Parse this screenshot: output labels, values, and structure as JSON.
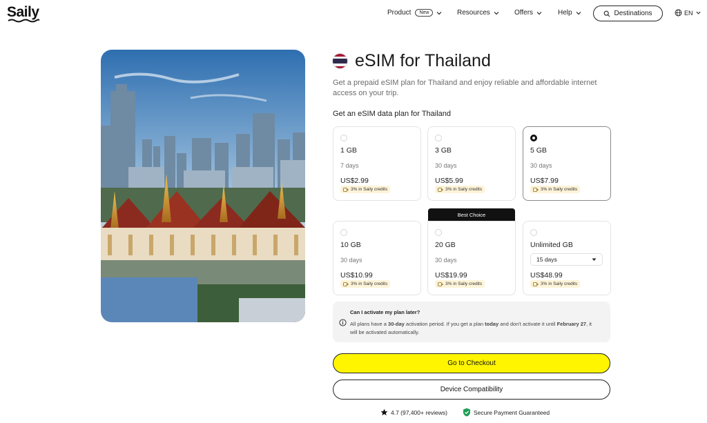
{
  "nav": {
    "logo": "Saily",
    "items": [
      {
        "label": "Product",
        "badge": "New"
      },
      {
        "label": "Resources"
      },
      {
        "label": "Offers"
      },
      {
        "label": "Help"
      }
    ],
    "destinations_label": "Destinations",
    "language": "EN"
  },
  "page": {
    "title": "eSIM for Thailand",
    "subtitle": "Get a prepaid eSIM plan for Thailand and enjoy reliable and affordable internet access on your trip.",
    "section_label": "Get an eSIM data plan for Thailand"
  },
  "flag_colors": [
    "#a51931",
    "#f4f5f8",
    "#2d2a4a",
    "#f4f5f8",
    "#a51931"
  ],
  "plans": [
    {
      "data": "1 GB",
      "days": "7 days",
      "price": "US$2.99",
      "credit": "3% in Saily credits",
      "selected": false
    },
    {
      "data": "3 GB",
      "days": "30 days",
      "price": "US$5.99",
      "credit": "3% in Saily credits",
      "selected": false
    },
    {
      "data": "5 GB",
      "days": "30 days",
      "price": "US$7.99",
      "credit": "3% in Saily credits",
      "selected": true
    },
    {
      "data": "10 GB",
      "days": "30 days",
      "price": "US$10.99",
      "credit": "3% in Saily credits",
      "selected": false
    },
    {
      "data": "20 GB",
      "days": "30 days",
      "price": "US$19.99",
      "credit": "3% in Saily credits",
      "selected": false,
      "tag": "Best Choice"
    },
    {
      "data": "Unlimited GB",
      "days": "15 days",
      "price": "US$48.99",
      "credit": "3% in Saily credits",
      "selected": false
    }
  ],
  "info": {
    "question": "Can I activate my plan later?",
    "text_1": "All plans have a ",
    "text_b1": "30-day",
    "text_2": " activation period. If you get a plan ",
    "text_b2": "today",
    "text_3": " and don't activate it until ",
    "text_b3": "February 27",
    "text_4": ", it will be activated automatically."
  },
  "buttons": {
    "checkout": "Go to Checkout",
    "compat": "Device Compatibility"
  },
  "footer": {
    "rating": "4.7 (97,400+ reviews)",
    "secure": "Secure Payment Guaranteed"
  },
  "colors": {
    "accent": "#fff500",
    "credit_bg": "#fdf3d8",
    "secure_green": "#1e9e57"
  }
}
